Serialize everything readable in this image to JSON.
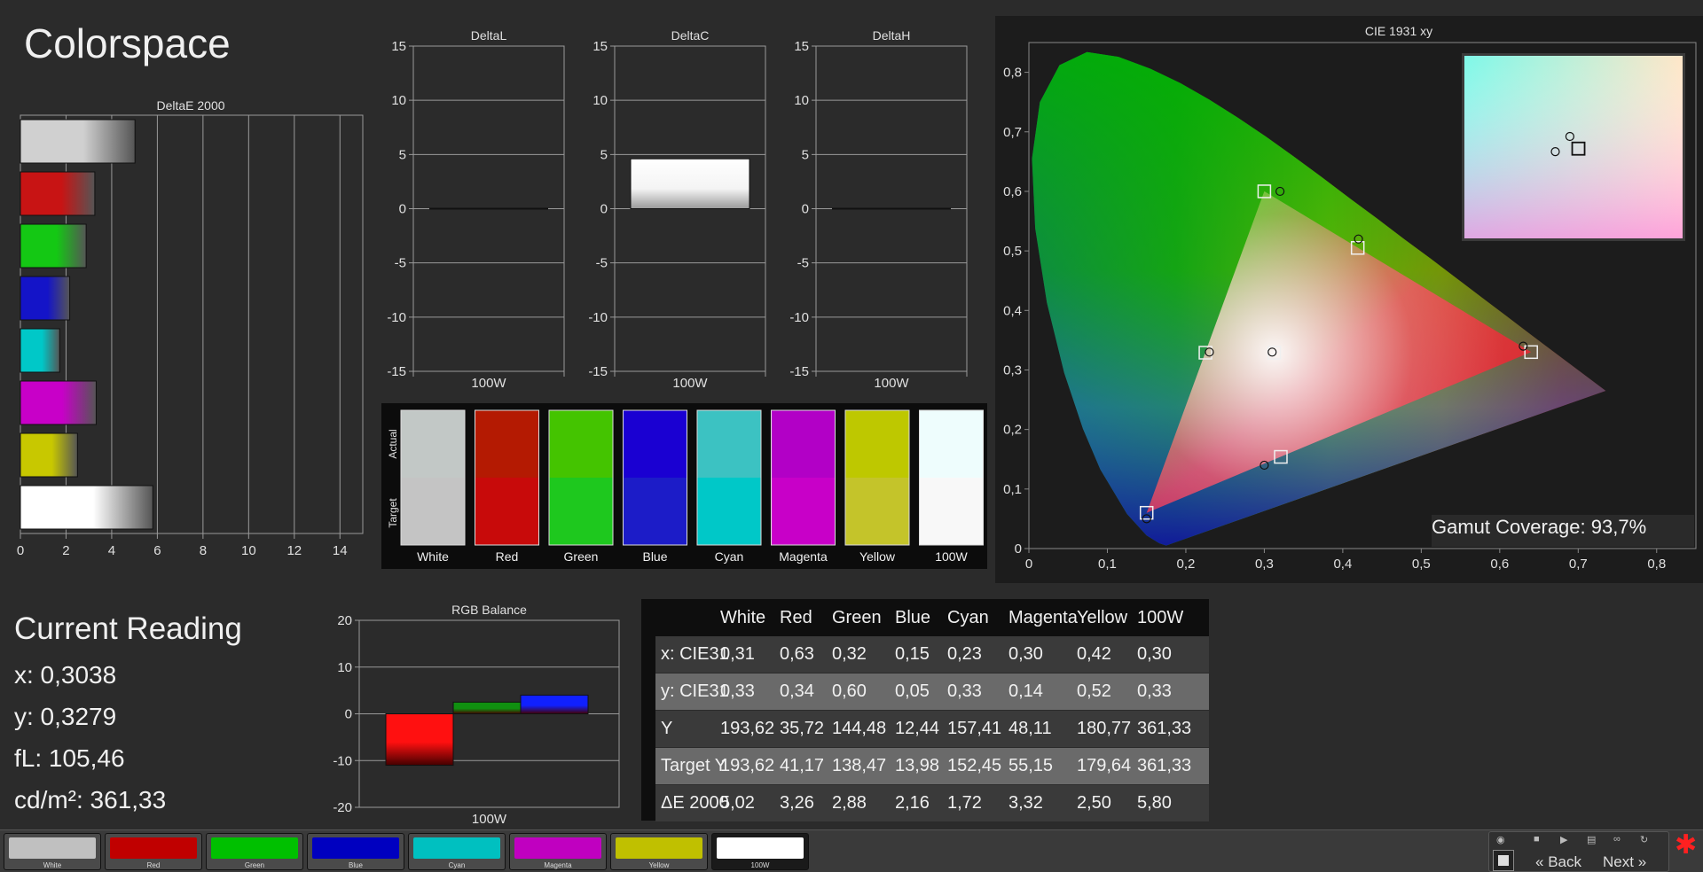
{
  "page": {
    "title": "Colorspace",
    "current_reading": {
      "title": "Current Reading",
      "lines": [
        "x: 0,3038",
        "y: 0,3279",
        "fL: 105,46",
        "cd/m²: 361,33"
      ]
    },
    "gamut_coverage": "Gamut Coverage:  93,7%",
    "buttons": [
      {
        "label": "White",
        "color": "#c0c0c0"
      },
      {
        "label": "Red",
        "color": "#c00000"
      },
      {
        "label": "Green",
        "color": "#00c000"
      },
      {
        "label": "Blue",
        "color": "#0000c0"
      },
      {
        "label": "Cyan",
        "color": "#00c0c0"
      },
      {
        "label": "Magenta",
        "color": "#c000c0"
      },
      {
        "label": "Yellow",
        "color": "#c0c000"
      },
      {
        "label": "100W",
        "color": "#ffffff"
      }
    ],
    "nav": {
      "back": "Back",
      "next": "Next"
    }
  },
  "chart_data": [
    {
      "type": "bar",
      "id": "deltae",
      "title": "DeltaE 2000",
      "orientation": "horizontal",
      "categories": [
        "100W",
        "Yellow",
        "Magenta",
        "Cyan",
        "Blue",
        "Green",
        "Red",
        "White"
      ],
      "values": [
        5.8,
        2.5,
        3.32,
        1.72,
        2.16,
        2.88,
        3.26,
        5.02
      ],
      "colors": [
        "#ffffff",
        "#c8c800",
        "#c800c8",
        "#00c8c8",
        "#1414c8",
        "#14c814",
        "#c81414",
        "#d0d0d0"
      ],
      "xlim": [
        0,
        15
      ],
      "xticks": [
        "0",
        "2",
        "4",
        "6",
        "8",
        "10",
        "12",
        "14"
      ]
    },
    {
      "type": "bar",
      "id": "deltal",
      "title": "DeltaL",
      "categories": [
        "100W"
      ],
      "values": [
        0.0
      ],
      "ylim": [
        -15,
        15
      ],
      "yticks": [
        "15",
        "10",
        "5",
        "0",
        "-5",
        "-10",
        "-15"
      ]
    },
    {
      "type": "bar",
      "id": "deltac",
      "title": "DeltaC",
      "categories": [
        "100W"
      ],
      "values": [
        4.6
      ],
      "ylim": [
        -15,
        15
      ],
      "yticks": [
        "15",
        "10",
        "5",
        "0",
        "-5",
        "-10",
        "-15"
      ]
    },
    {
      "type": "bar",
      "id": "deltah",
      "title": "DeltaH",
      "categories": [
        "100W"
      ],
      "values": [
        0.0
      ],
      "ylim": [
        -15,
        15
      ],
      "yticks": [
        "15",
        "10",
        "5",
        "0",
        "-5",
        "-10",
        "-15"
      ]
    },
    {
      "type": "table",
      "id": "swatches",
      "row_labels": [
        "Actual",
        "Target"
      ],
      "columns": [
        "White",
        "Red",
        "Green",
        "Blue",
        "Cyan",
        "Magenta",
        "Yellow",
        "100W"
      ],
      "actual": [
        "#c2c8c6",
        "#b41a02",
        "#44c400",
        "#1a00d2",
        "#3cc2c2",
        "#b200c6",
        "#bec800",
        "#eefdfd"
      ],
      "target": [
        "#c4c4c4",
        "#c80a0a",
        "#1ec81e",
        "#1c1cc8",
        "#00c8c8",
        "#c800c8",
        "#c4c42a",
        "#f8f8f8"
      ]
    },
    {
      "type": "scatter",
      "id": "cie",
      "title": "CIE 1931 xy",
      "xlim": [
        0,
        0.85
      ],
      "ylim": [
        0,
        0.85
      ],
      "xticks": [
        "0",
        "0,1",
        "0,2",
        "0,3",
        "0,4",
        "0,5",
        "0,6",
        "0,7",
        "0,8"
      ],
      "yticks": [
        "0",
        "0,1",
        "0,2",
        "0,3",
        "0,4",
        "0,5",
        "0,6",
        "0,7",
        "0,8"
      ],
      "targets": [
        [
          0.64,
          0.33
        ],
        [
          0.3,
          0.6
        ],
        [
          0.15,
          0.06
        ],
        [
          0.225,
          0.329
        ],
        [
          0.321,
          0.154
        ],
        [
          0.419,
          0.505
        ],
        [
          0.3127,
          0.329
        ]
      ],
      "measured": [
        [
          0.63,
          0.34
        ],
        [
          0.32,
          0.6
        ],
        [
          0.15,
          0.05
        ],
        [
          0.23,
          0.33
        ],
        [
          0.3,
          0.14
        ],
        [
          0.42,
          0.52
        ],
        [
          0.31,
          0.33
        ]
      ]
    },
    {
      "type": "bar",
      "id": "rgb",
      "title": "RGB Balance",
      "categories": [
        "100W"
      ],
      "series": [
        {
          "name": "R",
          "values": [
            -11
          ]
        },
        {
          "name": "G",
          "values": [
            2.5
          ]
        },
        {
          "name": "B",
          "values": [
            4
          ]
        }
      ],
      "colors": [
        "#ff1010",
        "#109010",
        "#1020ff"
      ],
      "ylim": [
        -20,
        20
      ],
      "yticks": [
        "20",
        "10",
        "0",
        "-10",
        "-20"
      ],
      "xlabel": "100W"
    },
    {
      "type": "table",
      "id": "values",
      "columns": [
        "White",
        "Red",
        "Green",
        "Blue",
        "Cyan",
        "Magenta",
        "Yellow",
        "100W"
      ],
      "rows": [
        {
          "label": "x: CIE31",
          "values": [
            "0,31",
            "0,63",
            "0,32",
            "0,15",
            "0,23",
            "0,30",
            "0,42",
            "0,30"
          ]
        },
        {
          "label": "y: CIE31",
          "values": [
            "0,33",
            "0,34",
            "0,60",
            "0,05",
            "0,33",
            "0,14",
            "0,52",
            "0,33"
          ]
        },
        {
          "label": "Y",
          "values": [
            "193,62",
            "35,72",
            "144,48",
            "12,44",
            "157,41",
            "48,11",
            "180,77",
            "361,33"
          ]
        },
        {
          "label": "Target Y",
          "values": [
            "193,62",
            "41,17",
            "138,47",
            "13,98",
            "152,45",
            "55,15",
            "179,64",
            "361,33"
          ]
        },
        {
          "label": "ΔE 2000",
          "values": [
            "5,02",
            "3,26",
            "2,88",
            "2,16",
            "1,72",
            "3,32",
            "2,50",
            "5,80"
          ]
        }
      ]
    }
  ]
}
